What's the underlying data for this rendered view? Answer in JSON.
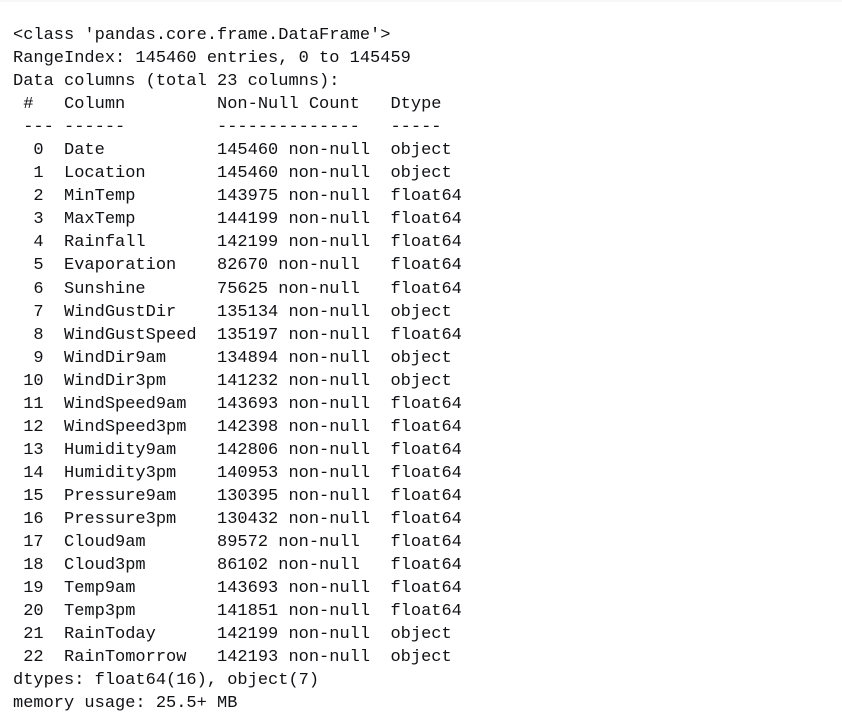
{
  "output": {
    "kind": "pandas-dataframe-info",
    "class_line": "<class 'pandas.core.frame.DataFrame'>",
    "range_index_line": "RangeIndex: 145460 entries, 0 to 145459",
    "data_columns_line": "Data columns (total 23 columns):",
    "header": {
      "index_label": "#",
      "column_label": "Column",
      "non_null_label": "Non-Null Count",
      "dtype_label": "Dtype"
    },
    "separator": {
      "index_rule": "---",
      "column_rule": "------",
      "non_null_rule": "--------------",
      "dtype_rule": "-----"
    },
    "non_null_suffix": "non-null",
    "rows": [
      {
        "index": "0",
        "column": "Date",
        "count": "145460",
        "dtype": "object"
      },
      {
        "index": "1",
        "column": "Location",
        "count": "145460",
        "dtype": "object"
      },
      {
        "index": "2",
        "column": "MinTemp",
        "count": "143975",
        "dtype": "float64"
      },
      {
        "index": "3",
        "column": "MaxTemp",
        "count": "144199",
        "dtype": "float64"
      },
      {
        "index": "4",
        "column": "Rainfall",
        "count": "142199",
        "dtype": "float64"
      },
      {
        "index": "5",
        "column": "Evaporation",
        "count": "82670",
        "dtype": "float64"
      },
      {
        "index": "6",
        "column": "Sunshine",
        "count": "75625",
        "dtype": "float64"
      },
      {
        "index": "7",
        "column": "WindGustDir",
        "count": "135134",
        "dtype": "object"
      },
      {
        "index": "8",
        "column": "WindGustSpeed",
        "count": "135197",
        "dtype": "float64"
      },
      {
        "index": "9",
        "column": "WindDir9am",
        "count": "134894",
        "dtype": "object"
      },
      {
        "index": "10",
        "column": "WindDir3pm",
        "count": "141232",
        "dtype": "object"
      },
      {
        "index": "11",
        "column": "WindSpeed9am",
        "count": "143693",
        "dtype": "float64"
      },
      {
        "index": "12",
        "column": "WindSpeed3pm",
        "count": "142398",
        "dtype": "float64"
      },
      {
        "index": "13",
        "column": "Humidity9am",
        "count": "142806",
        "dtype": "float64"
      },
      {
        "index": "14",
        "column": "Humidity3pm",
        "count": "140953",
        "dtype": "float64"
      },
      {
        "index": "15",
        "column": "Pressure9am",
        "count": "130395",
        "dtype": "float64"
      },
      {
        "index": "16",
        "column": "Pressure3pm",
        "count": "130432",
        "dtype": "float64"
      },
      {
        "index": "17",
        "column": "Cloud9am",
        "count": "89572",
        "dtype": "float64"
      },
      {
        "index": "18",
        "column": "Cloud3pm",
        "count": "86102",
        "dtype": "float64"
      },
      {
        "index": "19",
        "column": "Temp9am",
        "count": "143693",
        "dtype": "float64"
      },
      {
        "index": "20",
        "column": "Temp3pm",
        "count": "141851",
        "dtype": "float64"
      },
      {
        "index": "21",
        "column": "RainToday",
        "count": "142199",
        "dtype": "object"
      },
      {
        "index": "22",
        "column": "RainTomorrow",
        "count": "142193",
        "dtype": "object"
      }
    ],
    "dtypes_line": "dtypes: float64(16), object(7)",
    "memory_usage_line": "memory usage: 25.5+ MB"
  },
  "layout": {
    "col_index_start": 1,
    "col_index_width": 3,
    "col_name_start": 5,
    "col_name_width": 15,
    "col_count_start": 20,
    "col_count_width": 17,
    "col_dtype_start": 37
  },
  "colors": {
    "background": "#ffffff",
    "text": "#101114",
    "top_strip": "#f7f8f9"
  }
}
